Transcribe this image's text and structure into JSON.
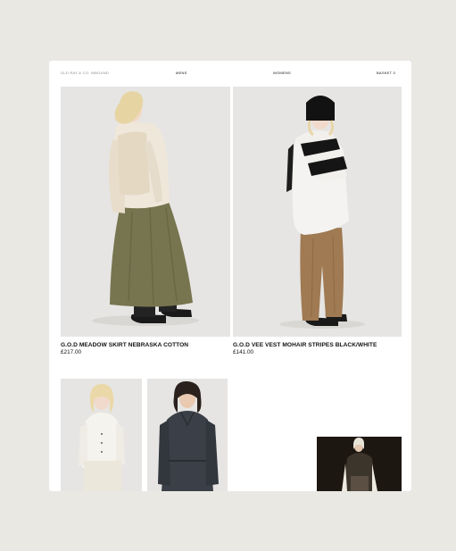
{
  "nav": {
    "brand": "OLD RAY & CO. INBOUND",
    "mens": "MENS",
    "womens": "WOMENS",
    "basket": "BASKET 0"
  },
  "products": [
    {
      "name": "G.O.D MEADOW SKIRT NEBRASKA COTTON",
      "price": "£217.00"
    },
    {
      "name": "G.O.D VEE VEST MOHAIR STRIPES BLACK/WHITE",
      "price": "£141.00"
    }
  ],
  "colors": {
    "page_bg": "#e9e8e3",
    "card_bg": "#ffffff",
    "photo_bg": "#e4e3e1"
  }
}
